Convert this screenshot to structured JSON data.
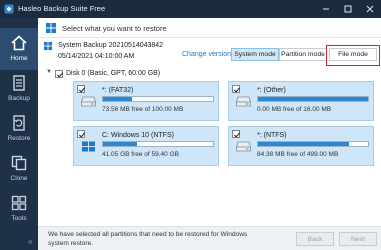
{
  "window": {
    "title": "Hasleo Backup Suite Free",
    "controls": [
      "minimize",
      "maximize",
      "close"
    ]
  },
  "sidebar": {
    "items": [
      {
        "label": "Home",
        "icon": "home-icon",
        "active": true
      },
      {
        "label": "Backup",
        "icon": "backup-icon",
        "active": false
      },
      {
        "label": "Restore",
        "icon": "restore-icon",
        "active": false
      },
      {
        "label": "Clone",
        "icon": "clone-icon",
        "active": false
      },
      {
        "label": "Tools",
        "icon": "tools-icon",
        "active": false
      }
    ],
    "collapse_glyph": "«"
  },
  "header": {
    "title": "Select what you want to restore"
  },
  "backup": {
    "name": "System Backup 20210514043842",
    "date": "05/14/2021 04:10:00 AM",
    "change_version": "Change version"
  },
  "modes": {
    "system": "System mode",
    "partition": "Partition mode",
    "file": "File mode",
    "selected": "system"
  },
  "disk": {
    "label": "Disk 0 (Basic, GPT, 60.00 GB)",
    "checked": true
  },
  "partitions": [
    {
      "name": "*: (FAT32)",
      "free": "73.56 MB free of 100.00 MB",
      "used_fraction": 0.26,
      "checked": true,
      "icon": "drive-icon"
    },
    {
      "name": "*: (Other)",
      "free": "0.00 MB free of 16.00 MB",
      "used_fraction": 1.0,
      "checked": true,
      "icon": "drive-icon"
    },
    {
      "name": "C: Windows 10 (NTFS)",
      "free": "41.05 GB free of 59.40 GB",
      "used_fraction": 0.31,
      "checked": true,
      "icon": "windows-drive-icon"
    },
    {
      "name": "*: (NTFS)",
      "free": "84.38 MB free of 499.00 MB",
      "used_fraction": 0.83,
      "checked": true,
      "icon": "drive-icon"
    }
  ],
  "footer": {
    "message": "We have selected all partitions that need to be restored for Windows system restore.",
    "back": "Back",
    "next": "Next"
  },
  "colors": {
    "sidebar": "#1e3146",
    "accent": "#2f86d1",
    "card": "#cfe6f8",
    "highlight": "#c9262a"
  }
}
